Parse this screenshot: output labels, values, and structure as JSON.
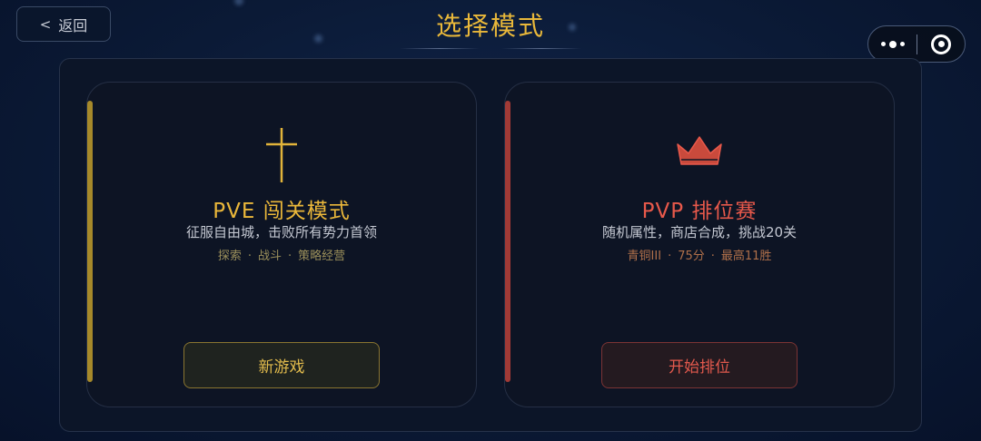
{
  "header": {
    "back_label": "返回",
    "back_chevron": "<",
    "title": "选择模式",
    "capsule": {
      "more_icon": "more-dots-icon",
      "close_icon": "target-close-icon"
    }
  },
  "modes": [
    {
      "id": "pve",
      "icon": "sword-icon",
      "title": "PVE 闯关模式",
      "description": "征服自由城，击败所有势力首领",
      "tags": [
        "探索",
        "战斗",
        "策略经营"
      ],
      "action_label": "新游戏",
      "accent_color": "#eab73a"
    },
    {
      "id": "pvp",
      "icon": "crown-icon",
      "title": "PVP 排位赛",
      "description": "随机属性，商店合成，挑战20关",
      "tags": [
        "青铜III",
        "75分",
        "最高11胜"
      ],
      "action_label": "开始排位",
      "accent_color": "#e8594b"
    }
  ],
  "tag_separator": "·"
}
